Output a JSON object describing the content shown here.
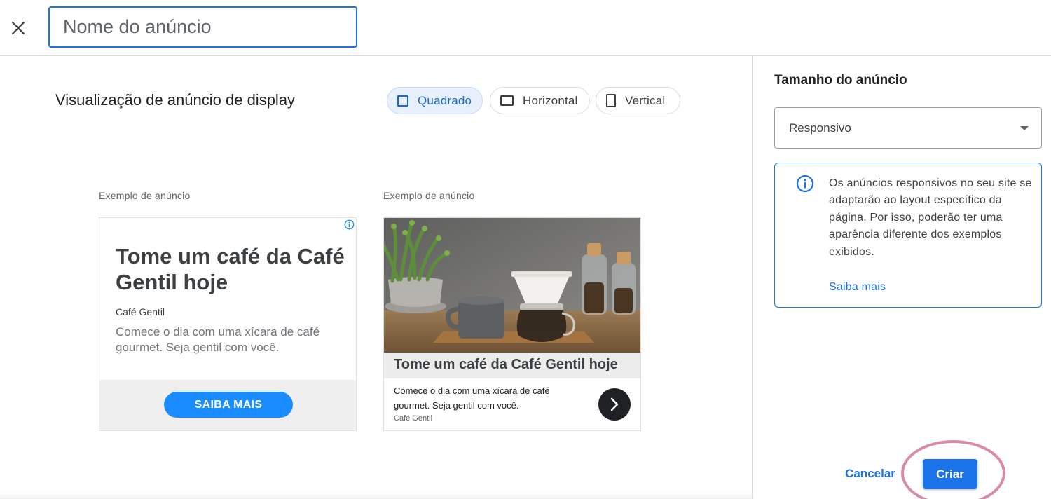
{
  "header": {
    "close_icon": "close-icon",
    "ad_name_placeholder": "Nome do anúncio",
    "ad_name_value": ""
  },
  "preview": {
    "title": "Visualização de anúncio de display",
    "formats": [
      {
        "label": "Quadrado",
        "icon": "square-icon",
        "selected": true
      },
      {
        "label": "Horizontal",
        "icon": "horizontal-rectangle-icon",
        "selected": false
      },
      {
        "label": "Vertical",
        "icon": "vertical-rectangle-icon",
        "selected": false
      }
    ],
    "examples": [
      {
        "caption": "Exemplo de anúncio",
        "headline": "Tome um café da Café Gentil hoje",
        "business": "Café Gentil",
        "description": "Comece o dia com uma xícara de café gourmet. Seja gentil com você.",
        "cta": "SAIBA MAIS",
        "info_icon": "ad-choices-info-icon"
      },
      {
        "caption": "Exemplo de anúncio",
        "image": "coffee-brewing-photo",
        "headline": "Tome um café da Café Gentil hoje",
        "description": "Comece o dia com uma xícara de café gourmet. Seja gentil com você.",
        "business": "Café Gentil",
        "arrow_icon": "chevron-right-icon"
      }
    ]
  },
  "sidebar": {
    "size_title": "Tamanho do anúncio",
    "size_value": "Responsivo",
    "info_icon": "info-icon",
    "info_text": "Os anúncios responsivos no seu site se adaptarão ao layout específico da página. Por isso, poderão ter uma aparência diferente dos exemplos exibidos.",
    "info_link": "Saiba mais"
  },
  "actions": {
    "cancel": "Cancelar",
    "create": "Criar"
  },
  "colors": {
    "accent": "#1a73e8",
    "cta_blue": "#1a8cff",
    "selected_bg": "#e8f0fe",
    "highlight_ring": "#d98aa8"
  }
}
